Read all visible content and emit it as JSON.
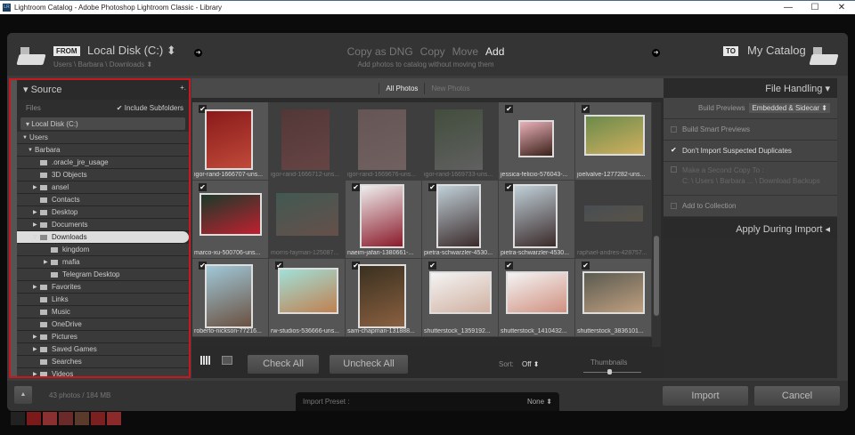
{
  "window": {
    "title": "Lightroom Catalog - Adobe Photoshop Lightroom Classic - Library",
    "app_badge": "LR",
    "minimize": "—",
    "maximize": "☐",
    "close": "✕"
  },
  "header": {
    "from_tag": "FROM",
    "source": "Local Disk (C:) ⬍",
    "source_path": "Users \\ Barbara \\ Downloads ⬍",
    "modes": [
      "Copy as DNG",
      "Copy",
      "Move",
      "Add"
    ],
    "active_mode": "Add",
    "mode_desc": "Add photos to catalog without moving them",
    "to_tag": "TO",
    "destination": "My Catalog"
  },
  "source": {
    "title": "Source",
    "add": "+.",
    "files_label": "Files",
    "include_subfolders": "Include Subfolders",
    "disk": "Local Disk (C:)",
    "tree": [
      {
        "label": "Users",
        "expand": "▼"
      },
      {
        "label": "Barbara",
        "expand": "▼"
      },
      {
        "label": ".oracle_jre_usage",
        "expand": ""
      },
      {
        "label": "3D Objects",
        "expand": ""
      },
      {
        "label": "ansel",
        "expand": "▶"
      },
      {
        "label": "Contacts",
        "expand": ""
      },
      {
        "label": "Desktop",
        "expand": "▶"
      },
      {
        "label": "Documents",
        "expand": "▶"
      },
      {
        "label": "Downloads",
        "expand": "▽"
      },
      {
        "label": "kingdom",
        "expand": ""
      },
      {
        "label": "mafia",
        "expand": "▶"
      },
      {
        "label": "Telegram Desktop",
        "expand": ""
      },
      {
        "label": "Favorites",
        "expand": "▶"
      },
      {
        "label": "Links",
        "expand": ""
      },
      {
        "label": "Music",
        "expand": ""
      },
      {
        "label": "OneDrive",
        "expand": ""
      },
      {
        "label": "Pictures",
        "expand": "▶"
      },
      {
        "label": "Saved Games",
        "expand": "▶"
      },
      {
        "label": "Searches",
        "expand": ""
      },
      {
        "label": "Videos",
        "expand": "▶"
      }
    ]
  },
  "grid": {
    "tabs": [
      "All Photos",
      "New Photos"
    ],
    "active_tab": "All Photos",
    "check": "✔",
    "photos": [
      {
        "name": "igor-rand-1666707-uns...",
        "checked": true,
        "colors": [
          "#8a1a1a",
          "#c04a3a"
        ]
      },
      {
        "name": "igor-rand-1666712-uns...",
        "checked": false,
        "colors": [
          "#7a2a2a",
          "#b05050"
        ]
      },
      {
        "name": "igor-rand-1669676-uns...",
        "checked": false,
        "colors": [
          "#b08080",
          "#d0a0a0"
        ]
      },
      {
        "name": "igor-rand-1669733-uns...",
        "checked": false,
        "colors": [
          "#4a6a3a",
          "#a0a0a0"
        ]
      },
      {
        "name": "jessica-felicio-576043-...",
        "checked": true,
        "colors": [
          "#e8b0b8",
          "#3a2018"
        ]
      },
      {
        "name": "joelvalve-1277282-uns...",
        "checked": true,
        "colors": [
          "#6a8a4a",
          "#d0b060"
        ]
      },
      {
        "name": "marco-xu-500706-uns...",
        "checked": true,
        "colors": [
          "#1a3a2a",
          "#c02030"
        ]
      },
      {
        "name": "morris-fayman-125087...",
        "checked": false,
        "colors": [
          "#4a8a7a",
          "#b07060"
        ]
      },
      {
        "name": "naeim-jafari-1380661-...",
        "checked": true,
        "colors": [
          "#eee",
          "#8a1a2a"
        ]
      },
      {
        "name": "pietra-schwarzler-4530...",
        "checked": true,
        "colors": [
          "#c0d0d8",
          "#3a2a2a"
        ]
      },
      {
        "name": "pietra-schwarzler-4530...",
        "checked": true,
        "colors": [
          "#c0d0d8",
          "#3a2a2a"
        ]
      },
      {
        "name": "raphael-andres-428757...",
        "checked": false,
        "colors": [
          "#5a6a7a",
          "#8a7a5a"
        ]
      },
      {
        "name": "roberto-nickson-77216...",
        "checked": true,
        "colors": [
          "#a0c8d8",
          "#6a5040"
        ]
      },
      {
        "name": "rw-studios-536666-uns...",
        "checked": true,
        "colors": [
          "#a0e0d8",
          "#c08050"
        ]
      },
      {
        "name": "sam-chapman-131888...",
        "checked": true,
        "colors": [
          "#3a3020",
          "#8a6040"
        ]
      },
      {
        "name": "shutterstock_1359192...",
        "checked": true,
        "colors": [
          "#f4f4f4",
          "#d0b0a0"
        ]
      },
      {
        "name": "shutterstock_1410432...",
        "checked": true,
        "colors": [
          "#f4f4f4",
          "#d09080"
        ]
      },
      {
        "name": "shutterstock_3836101...",
        "checked": true,
        "colors": [
          "#5a5a50",
          "#c0a080"
        ]
      }
    ]
  },
  "toolbar": {
    "check_all": "Check All",
    "uncheck_all": "Uncheck All",
    "sort_label": "Sort:",
    "sort_value": "Off ⬍",
    "thumbnails_label": "Thumbnails",
    "thumbnail_size": 0.45
  },
  "file_handling": {
    "title": "File Handling",
    "build_previews_label": "Build Previews",
    "build_previews_value": "Embedded & Sidecar ⬍",
    "smart_previews": "Build Smart Previews",
    "no_duplicates": "Don't Import Suspected Duplicates",
    "second_copy": "Make a Second Copy To :",
    "second_copy_path": "C: \\ Users \\ Barbara ... \\ Download Backups",
    "add_collection": "Add to Collection",
    "apply_during_import": "Apply During Import"
  },
  "footer": {
    "summary": "43 photos / 184 MB",
    "preset_label": "Import Preset :",
    "preset_value": "None ⬍",
    "import": "Import",
    "cancel": "Cancel",
    "expand": "▲"
  }
}
